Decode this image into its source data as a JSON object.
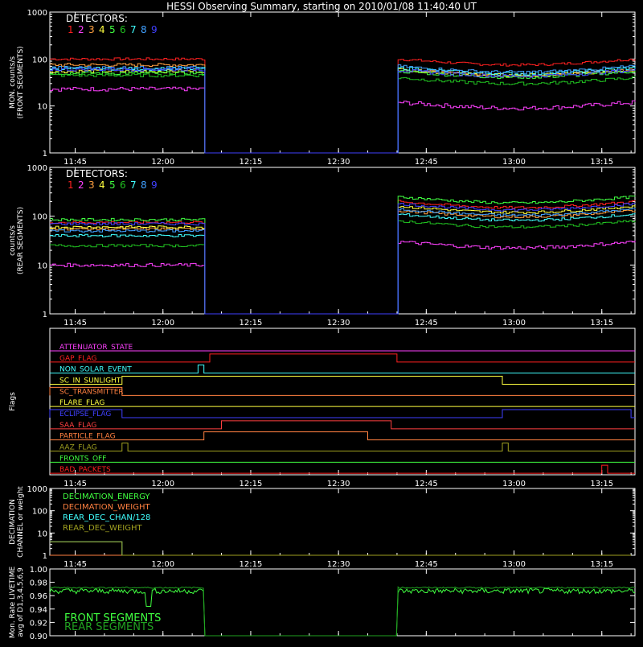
{
  "title": "HESSI Observing Summary, starting on 2010/01/08 11:40:40 UT",
  "time_ticks": [
    "11:45",
    "12:00",
    "12:15",
    "12:30",
    "12:45",
    "13:00",
    "13:15"
  ],
  "detector_colors": [
    "#ff2020",
    "#ff40ff",
    "#ffa040",
    "#ffff40",
    "#40ff40",
    "#20c020",
    "#40ffff",
    "#40a0ff",
    "#4040ff"
  ],
  "chart_data": [
    {
      "type": "line",
      "ylabel": "MON. counts/s\n(FRONT SEGMENTS)",
      "yscale": "log",
      "ylim": [
        1,
        1000
      ],
      "ytick_labels": [
        "1",
        "10",
        "100",
        "1000"
      ],
      "legend_title": "DETECTORS:",
      "legend_items": [
        "1",
        "2",
        "3",
        "4",
        "5",
        "6",
        "7",
        "8",
        "9"
      ],
      "gap": [
        "12:07",
        "12:40"
      ],
      "series": [
        {
          "name": "1",
          "level_before": 100,
          "level_after": 100,
          "noise": 0.06
        },
        {
          "name": "2",
          "level_before": 23,
          "level_after": 12,
          "noise": 0.1
        },
        {
          "name": "3",
          "level_before": 75,
          "level_after": 60,
          "noise": 0.08
        },
        {
          "name": "4",
          "level_before": 55,
          "level_after": 60,
          "noise": 0.08
        },
        {
          "name": "5",
          "level_before": 50,
          "level_after": 55,
          "noise": 0.08
        },
        {
          "name": "6",
          "level_before": 45,
          "level_after": 40,
          "noise": 0.08
        },
        {
          "name": "7",
          "level_before": 62,
          "level_after": 65,
          "noise": 0.08
        },
        {
          "name": "8",
          "level_before": 65,
          "level_after": 70,
          "noise": 0.08
        },
        {
          "name": "9",
          "level_before": 60,
          "level_after": 58,
          "noise": 0.08
        }
      ]
    },
    {
      "type": "line",
      "ylabel": "counts/s\n(REAR SEGMENTS)",
      "yscale": "log",
      "ylim": [
        1,
        1000
      ],
      "ytick_labels": [
        "1",
        "10",
        "100",
        "1000"
      ],
      "legend_title": "DETECTORS:",
      "legend_items": [
        "1",
        "2",
        "3",
        "4",
        "5",
        "6",
        "7",
        "8",
        "9"
      ],
      "gap": [
        "12:07",
        "12:40"
      ],
      "series": [
        {
          "name": "1",
          "level_before": 75,
          "level_after": 200,
          "noise": 0.06
        },
        {
          "name": "2",
          "level_before": 10,
          "level_after": 30,
          "noise": 0.08
        },
        {
          "name": "3",
          "level_before": 55,
          "level_after": 130,
          "noise": 0.06
        },
        {
          "name": "4",
          "level_before": 60,
          "level_after": 160,
          "noise": 0.06
        },
        {
          "name": "5",
          "level_before": 85,
          "level_after": 250,
          "noise": 0.06
        },
        {
          "name": "6",
          "level_before": 25,
          "level_after": 80,
          "noise": 0.06
        },
        {
          "name": "7",
          "level_before": 40,
          "level_after": 110,
          "noise": 0.06
        },
        {
          "name": "8",
          "level_before": 50,
          "level_after": 140,
          "noise": 0.06
        },
        {
          "name": "9",
          "level_before": 70,
          "level_after": 180,
          "noise": 0.06
        }
      ]
    },
    {
      "type": "step",
      "ylabel": "Flags",
      "flags": [
        {
          "name": "ATTENUATOR_STATE",
          "color": "#ff40ff",
          "state": []
        },
        {
          "name": "GAP_FLAG",
          "color": "#ff2020",
          "state": [
            [
              "12:08",
              "12:40"
            ]
          ]
        },
        {
          "name": "NON_SOLAR_EVENT",
          "color": "#40ffff",
          "state": [
            [
              "12:06",
              "12:07"
            ]
          ]
        },
        {
          "name": "SC_IN_SUNLIGHT",
          "color": "#ffff40",
          "state": [
            [
              "11:53",
              "12:58"
            ]
          ]
        },
        {
          "name": "SC_TRANSMITTER",
          "color": "#ff8040",
          "state": [
            [
              "11:40",
              "11:53"
            ]
          ]
        },
        {
          "name": "FLARE_FLAG",
          "color": "#ffff40",
          "state": []
        },
        {
          "name": "ECLIPSE_FLAG",
          "color": "#4040ff",
          "state": [
            [
              "11:40",
              "11:53"
            ],
            [
              "12:58",
              "13:20"
            ]
          ]
        },
        {
          "name": "SAA_FLAG",
          "color": "#ff4040",
          "state": [
            [
              "12:10",
              "12:39"
            ]
          ]
        },
        {
          "name": "PARTICLE_FLAG",
          "color": "#ff8040",
          "state": [
            [
              "12:07",
              "12:35"
            ]
          ]
        },
        {
          "name": "AAZ_FLAG",
          "color": "#a0a020",
          "state": [
            [
              "11:53",
              "11:54"
            ],
            [
              "12:58",
              "12:59"
            ]
          ]
        },
        {
          "name": "FRONTS_OFF",
          "color": "#40ff40",
          "state": []
        },
        {
          "name": "BAD_PACKETS",
          "color": "#ff2020",
          "state": [
            [
              "13:15",
              "13:16"
            ]
          ]
        }
      ]
    },
    {
      "type": "line",
      "ylabel": "DECIMATION\nCHANNEL or weight",
      "yscale": "log",
      "ylim": [
        1,
        1000
      ],
      "ytick_labels": [
        "1",
        "10",
        "100",
        "1000"
      ],
      "legend_items": [
        "DECIMATION_ENERGY",
        "DECIMATION_WEIGHT",
        "REAR_DEC_CHAN/128",
        "REAR_DEC_WEIGHT"
      ],
      "series": [
        {
          "name": "DECIMATION_ENERGY",
          "color": "#40ff40",
          "points": [
            [
              "11:40",
              1
            ],
            [
              "13:20",
              1
            ]
          ]
        },
        {
          "name": "DECIMATION_WEIGHT",
          "color": "#ff8040",
          "points": [
            [
              "11:40",
              1
            ],
            [
              "13:20",
              1
            ]
          ]
        },
        {
          "name": "REAR_DEC_CHAN/128",
          "color": "#40ffff",
          "points": [
            [
              "11:40",
              4
            ],
            [
              "11:53",
              4
            ],
            [
              "11:53",
              1
            ],
            [
              "13:20",
              1
            ]
          ]
        },
        {
          "name": "REAR_DEC_WEIGHT",
          "color": "#a0a020",
          "points": [
            [
              "11:40",
              4
            ],
            [
              "11:53",
              4
            ],
            [
              "11:53",
              1
            ],
            [
              "13:20",
              1
            ]
          ]
        }
      ]
    },
    {
      "type": "line",
      "ylabel": "Mon. Rate LIVETIME\navg of D1,3,4,5,6,9",
      "ylim": [
        0.9,
        1.0
      ],
      "ytick_labels": [
        "0.90",
        "0.92",
        "0.94",
        "0.96",
        "0.98",
        "1.00"
      ],
      "legend_items": [
        "FRONT SEGMENTS",
        "REAR SEGMENTS"
      ],
      "gap": [
        "12:07",
        "12:40"
      ],
      "series": [
        {
          "name": "FRONT SEGMENTS",
          "color": "#40ff40",
          "level": 0.967,
          "noise": 0.004
        },
        {
          "name": "REAR SEGMENTS",
          "color": "#20a020",
          "level": 0.972,
          "noise": 0.001
        }
      ]
    }
  ]
}
